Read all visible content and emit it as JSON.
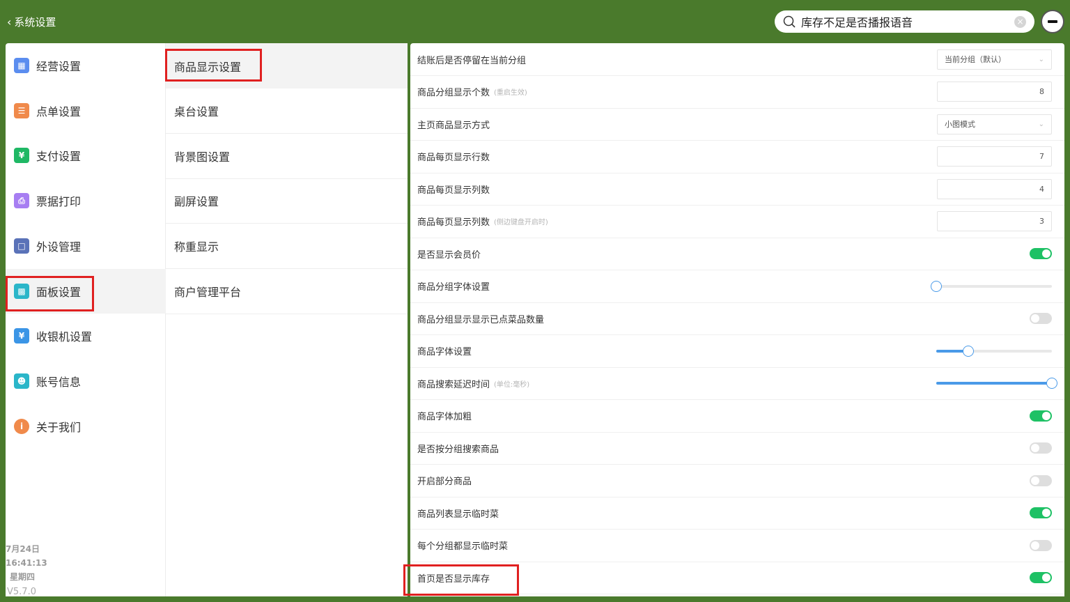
{
  "header": {
    "back_label": "系统设置",
    "search_value": "库存不足是否播报语音"
  },
  "nav1": [
    {
      "label": "经营设置",
      "icon": "store-icon",
      "color": "#5b8def"
    },
    {
      "label": "点单设置",
      "icon": "order-icon",
      "color": "#f08a4b"
    },
    {
      "label": "支付设置",
      "icon": "yuan-icon",
      "color": "#1fb865"
    },
    {
      "label": "票据打印",
      "icon": "printer-icon",
      "color": "#a77ef2"
    },
    {
      "label": "外设管理",
      "icon": "monitor-icon",
      "color": "#5a72b8"
    },
    {
      "label": "面板设置",
      "icon": "panel-icon",
      "color": "#2bb6c9"
    },
    {
      "label": "收银机设置",
      "icon": "cashier-icon",
      "color": "#3b95e6"
    },
    {
      "label": "账号信息",
      "icon": "account-icon",
      "color": "#2bb6c9"
    },
    {
      "label": "关于我们",
      "icon": "info-icon",
      "color": "#f08a4b"
    }
  ],
  "nav2": [
    {
      "label": "商品显示设置"
    },
    {
      "label": "桌台设置"
    },
    {
      "label": "背景图设置"
    },
    {
      "label": "副屏设置"
    },
    {
      "label": "称重显示"
    },
    {
      "label": "商户管理平台"
    }
  ],
  "footer": {
    "date": "7月24日",
    "time": "16:41:13",
    "weekday": "星期四",
    "version": "V5.7.0"
  },
  "settings": [
    {
      "label": "结账后是否停留在当前分组",
      "hint": "",
      "control": "select",
      "value": "当前分组（默认）"
    },
    {
      "label": "商品分组显示个数",
      "hint": "(重启生效)",
      "control": "number",
      "value": "8"
    },
    {
      "label": "主页商品显示方式",
      "hint": "",
      "control": "select",
      "value": "小图模式"
    },
    {
      "label": "商品每页显示行数",
      "hint": "",
      "control": "number",
      "value": "7"
    },
    {
      "label": "商品每页显示列数",
      "hint": "",
      "control": "number",
      "value": "4"
    },
    {
      "label": "商品每页显示列数",
      "hint": "(侧边键盘开启时)",
      "control": "number",
      "value": "3"
    },
    {
      "label": "是否显示会员价",
      "hint": "",
      "control": "toggle",
      "on": true
    },
    {
      "label": "商品分组字体设置",
      "hint": "",
      "control": "slider",
      "level": 0
    },
    {
      "label": "商品分组显示显示已点菜品数量",
      "hint": "",
      "control": "toggle",
      "on": false
    },
    {
      "label": "商品字体设置",
      "hint": "",
      "control": "slider",
      "level": 0.28
    },
    {
      "label": "商品搜索延迟时间",
      "hint": "(单位:毫秒)",
      "control": "slider",
      "level": 1
    },
    {
      "label": "商品字体加粗",
      "hint": "",
      "control": "toggle",
      "on": true
    },
    {
      "label": "是否按分组搜索商品",
      "hint": "",
      "control": "toggle",
      "on": false
    },
    {
      "label": "开启部分商品",
      "hint": "",
      "control": "toggle",
      "on": false
    },
    {
      "label": "商品列表显示临时菜",
      "hint": "",
      "control": "toggle",
      "on": true
    },
    {
      "label": "每个分组都显示临时菜",
      "hint": "",
      "control": "toggle",
      "on": false
    },
    {
      "label": "首页是否显示库存",
      "hint": "",
      "control": "toggle",
      "on": true
    }
  ],
  "colors": {
    "background": "#4a7a2c",
    "toggle_on": "#1ec165",
    "slider": "#4a9ae8",
    "highlight": "#e02020"
  }
}
